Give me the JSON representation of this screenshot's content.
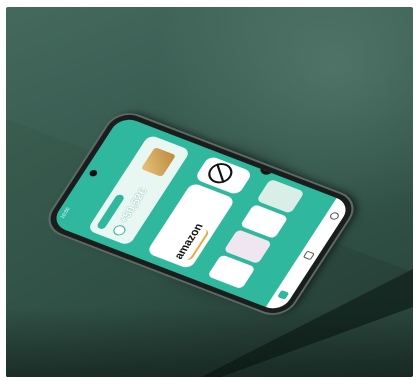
{
  "scene": {
    "colors": {
      "background": "#ffffff",
      "wall": "#44695d",
      "desk": "#3f6355",
      "desk_edge": "#1e332b",
      "app_green": "#2fb89d",
      "card": "#ffffff",
      "phone_frame": "#1a1d1c"
    }
  },
  "phone": {
    "status_time": "10:00",
    "greeting": "",
    "balance_card": {
      "pill_label": "",
      "value": "+50,52€"
    },
    "offers_label": "",
    "offer": {
      "description": "",
      "brand": "amazon"
    },
    "shops_label": "",
    "icons": {
      "balance": "coin-icon",
      "no_sign": "no-sign-icon",
      "euro": "euro-icon",
      "home": "home-icon",
      "scan": "scan-icon",
      "profile": "profile-icon"
    }
  }
}
